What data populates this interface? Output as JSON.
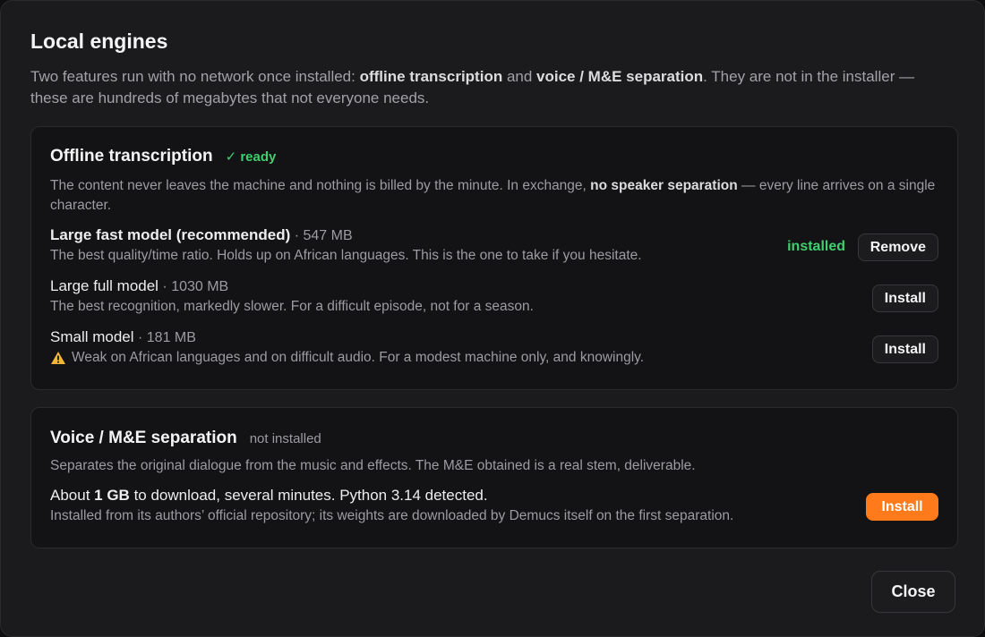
{
  "dialog": {
    "title": "Local engines",
    "intro": {
      "part1": "Two features run with no network once installed: ",
      "bold1": "offline transcription",
      "part2": " and ",
      "bold2": "voice / M&E separation",
      "part3": ". They are not in the installer — these are hundreds of megabytes that not everyone needs."
    },
    "close_label": "Close"
  },
  "transcription": {
    "title": "Offline transcription",
    "status": "✓ ready",
    "desc_part1": "The content never leaves the machine and nothing is billed by the minute. In exchange, ",
    "desc_bold": "no speaker separation",
    "desc_part2": " — every line arrives on a single character.",
    "models": [
      {
        "name": "Large fast model (recommended)",
        "size": " · 547 MB",
        "description": "The best quality/time ratio. Holds up on African languages. This is the one to take if you hesitate.",
        "state": "installed",
        "action": "Remove"
      },
      {
        "name": "Large full model",
        "size": " · 1030 MB",
        "description": "The best recognition, markedly slower. For a difficult episode, not for a season.",
        "action": "Install"
      },
      {
        "name": "Small model",
        "size": " · 181 MB",
        "description": "Weak on African languages and on difficult audio. For a modest machine only, and knowingly.",
        "action": "Install"
      }
    ]
  },
  "separation": {
    "title": "Voice / M&E separation",
    "status": "not installed",
    "desc": "Separates the original dialogue from the music and effects. The M&E obtained is a real stem, deliverable.",
    "info_part1": "About ",
    "info_bold": "1 GB",
    "info_part2": " to download, several minutes. Python 3.14 detected.",
    "info_sub": "Installed from its authors’ official repository; its weights are downloaded by Demucs itself on the first separation.",
    "action": "Install"
  },
  "colors": {
    "accent": "#ff7a1a",
    "ready": "#3fcf6e",
    "background": "#1b1b1d"
  }
}
